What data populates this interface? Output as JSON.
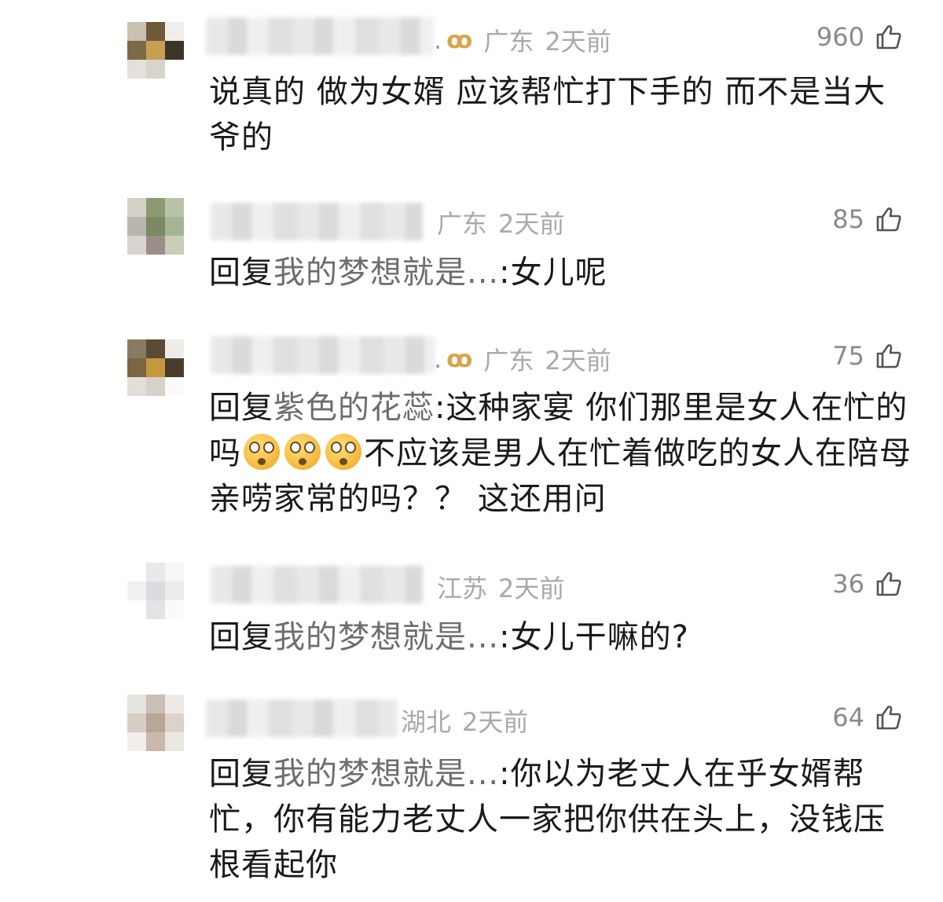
{
  "comments": [
    {
      "has_badge": true,
      "badge_icon": "ꝏ",
      "location": "广东",
      "time": "2天前",
      "likes": "960",
      "text": "说真的  做为女婿  应该帮忙打下手的  而不是当大爷的"
    },
    {
      "has_badge": false,
      "location": "广东",
      "time": "2天前",
      "likes": "85",
      "reply_keyword": "回复",
      "reply_to": "我的梦想就是...",
      "text": ":女儿呢"
    },
    {
      "has_badge": true,
      "badge_icon": "ꝏ",
      "location": "广东",
      "time": "2天前",
      "likes": "75",
      "reply_keyword": "回复",
      "reply_to": "紫色的花蕊",
      "text_before_emoji": ":这种家宴  你们那里是女人在忙的吗",
      "emoji_name": "flushed-face-emoji",
      "emoji_count": 3,
      "text_after_emoji": "不应该是男人在忙着做吃的女人在陪母亲唠家常的吗？？ 这还用问"
    },
    {
      "has_badge": false,
      "location": "江苏",
      "time": "2天前",
      "likes": "36",
      "reply_keyword": "回复",
      "reply_to": "我的梦想就是...",
      "text": ":女儿干嘛的?"
    },
    {
      "has_badge": false,
      "location": "湖北",
      "time": "2天前",
      "likes": "64",
      "reply_keyword": "回复",
      "reply_to": "我的梦想就是...",
      "text": ":你以为老丈人在乎女婿帮忙，你有能力老丈人一家把你供在头上，没钱压根看起你"
    }
  ],
  "icons": {
    "like": "thumbs-up-icon"
  },
  "colors": {
    "text": "#1a1a1a",
    "meta": "#a9a9a9",
    "reply_name": "#6d6d6d",
    "badge": "#d9a548"
  }
}
